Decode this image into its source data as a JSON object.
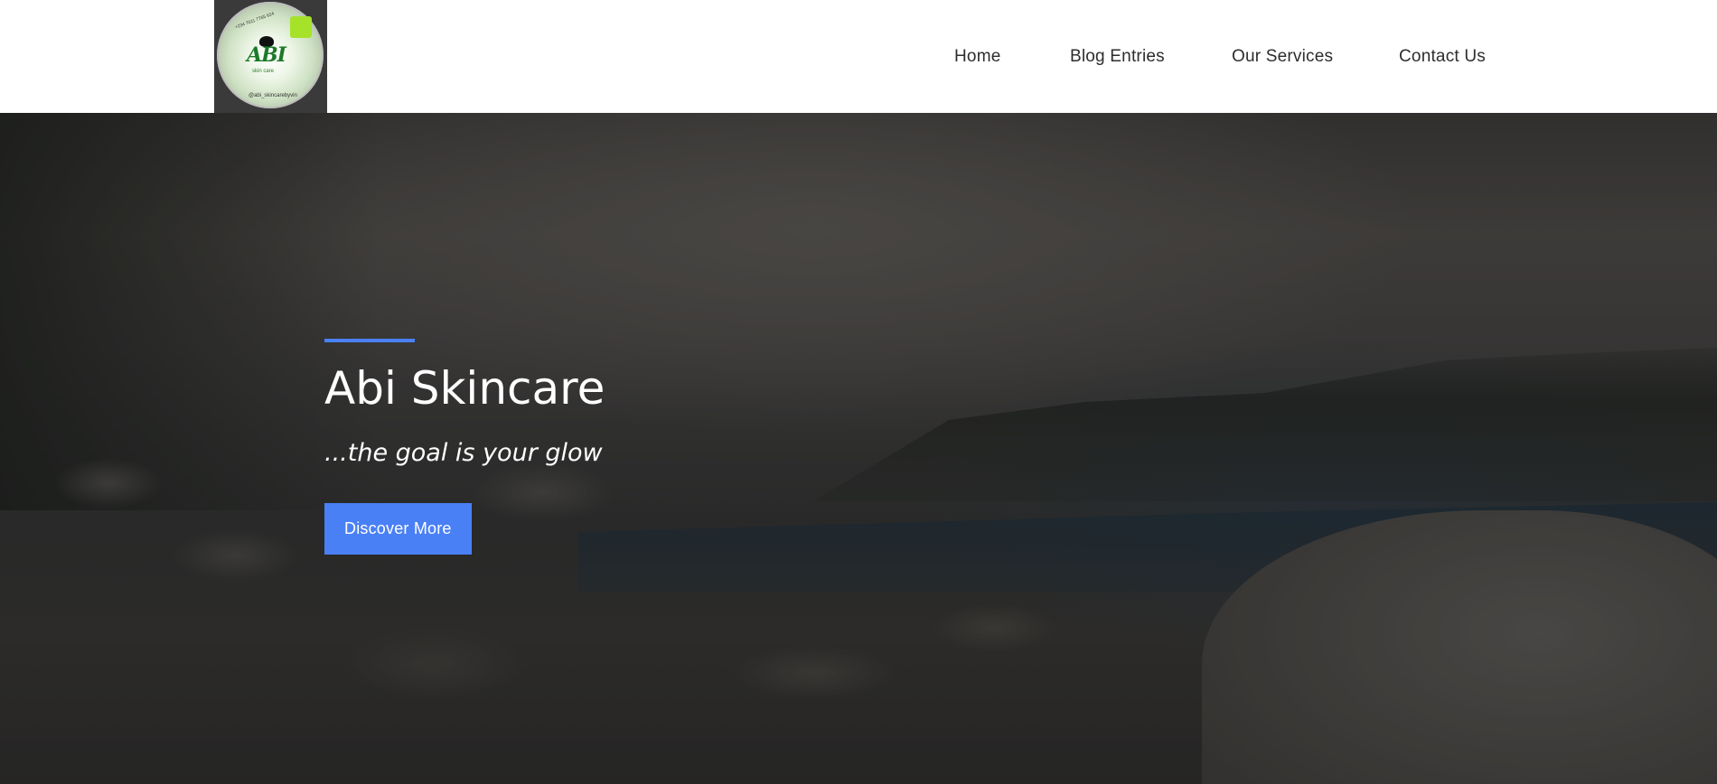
{
  "header": {
    "logo": {
      "text": "ABI",
      "small_text": "skin care",
      "handle": "@abi_skincarebyvin",
      "phone": "+234 7011 7765 624"
    },
    "nav": [
      {
        "label": "Home"
      },
      {
        "label": "Blog Entries"
      },
      {
        "label": "Our Services"
      },
      {
        "label": "Contact Us"
      }
    ]
  },
  "hero": {
    "title": "Abi Skincare",
    "tagline": "...the goal is your glow",
    "cta_label": "Discover More",
    "accent_color": "#4a80f5"
  },
  "colors": {
    "header_bg": "#ffffff",
    "nav_text": "#2d2d2d",
    "button_bg": "#4a80f5",
    "logo_green": "#a6e22a"
  }
}
